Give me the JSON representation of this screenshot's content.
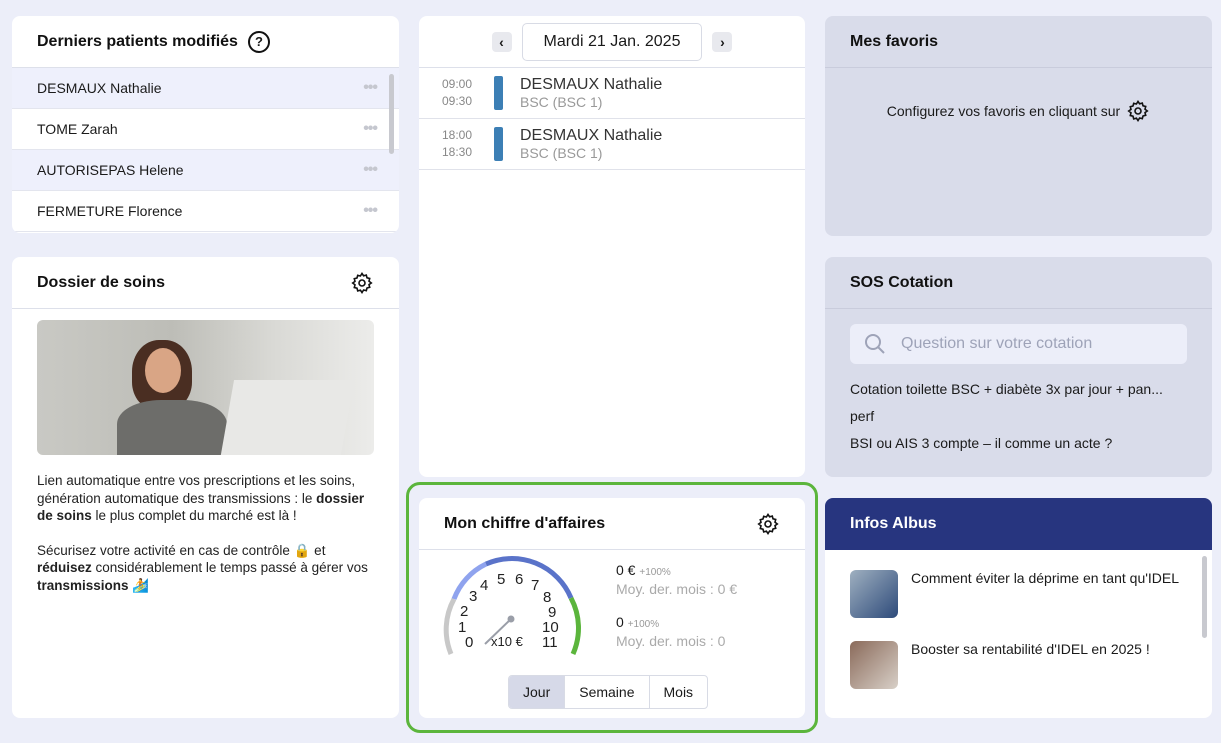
{
  "recent_patients": {
    "title": "Derniers patients modifiés",
    "patients": [
      "DESMAUX Nathalie",
      "TOME Zarah",
      "AUTORISEPAS Helene",
      "FERMETURE Florence"
    ]
  },
  "dossier": {
    "title": "Dossier de soins",
    "p1_a": "Lien automatique entre vos prescriptions et les soins, génération automatique des transmissions : le ",
    "p1_b": "dossier de soins",
    "p1_c": " le plus complet du marché est là !",
    "p2_a": "Sécurisez votre activité en cas de contrôle 🔒 et ",
    "p2_b": "réduisez",
    "p2_c": " considérablement le temps passé à gérer vos ",
    "p2_d": "transmissions",
    "p2_e": " 🏄"
  },
  "agenda": {
    "date": "Mardi 21 Jan. 2025",
    "appointments": [
      {
        "start": "09:00",
        "end": "09:30",
        "name": "DESMAUX Nathalie",
        "act": "BSC (BSC 1)"
      },
      {
        "start": "18:00",
        "end": "18:30",
        "name": "DESMAUX Nathalie",
        "act": "BSC (BSC 1)"
      }
    ]
  },
  "revenue": {
    "title": "Mon chiffre d'affaires",
    "gauge_value": 0,
    "gauge_unit": "x10 €",
    "ticks": [
      "0",
      "1",
      "2",
      "3",
      "4",
      "5",
      "6",
      "7",
      "8",
      "9",
      "10",
      "11"
    ],
    "amount": "0 €",
    "amount_change": "+100%",
    "amount_avg": "Moy. der. mois : 0 €",
    "count": "0",
    "count_change": "+100%",
    "count_avg": "Moy. der. mois : 0",
    "periods": [
      "Jour",
      "Semaine",
      "Mois"
    ],
    "active_period": "Jour"
  },
  "favorites": {
    "title": "Mes favoris",
    "text": "Configurez vos favoris en cliquant sur"
  },
  "sos": {
    "title": "SOS Cotation",
    "placeholder": "Question sur votre cotation",
    "questions": [
      "Cotation toilette BSC + diabète 3x par jour + pan...",
      "perf",
      "BSI ou AIS 3 compte – il comme un acte ?"
    ]
  },
  "infos": {
    "title": "Infos Albus",
    "articles": [
      "Comment éviter la déprime en tant qu'IDEL",
      "Booster sa rentabilité d'IDEL en 2025 !"
    ]
  },
  "colors": {
    "accent_green": "#5bb53c",
    "header_blue": "#27357f",
    "appt_bar": "#3c7fb5"
  }
}
